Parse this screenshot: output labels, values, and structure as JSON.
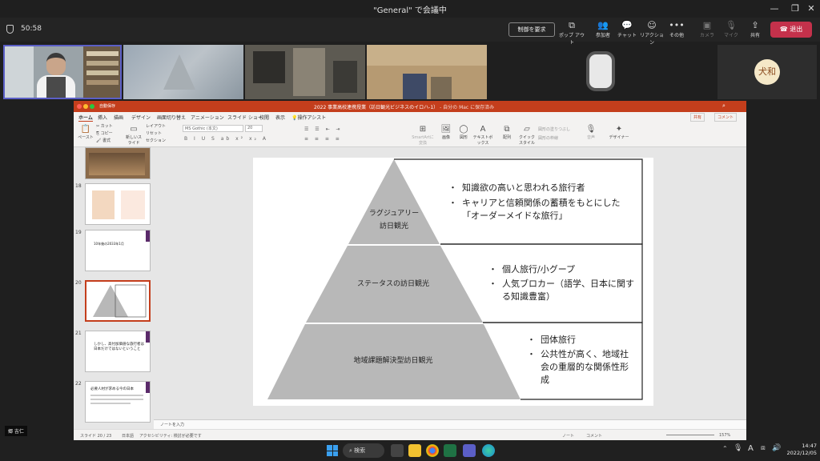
{
  "window": {
    "title": "\"General\" で会議中",
    "controls": {
      "minimize": "—",
      "maximize": "❐",
      "close": "✕"
    }
  },
  "meeting": {
    "timer": "50:58",
    "request_control": "制御を要求",
    "tools": [
      {
        "label": "ポップ アウト",
        "icon": "popout-icon"
      },
      {
        "label": "参加者",
        "icon": "people-icon"
      },
      {
        "label": "チャット",
        "icon": "chat-icon"
      },
      {
        "label": "リアクション",
        "icon": "reaction-icon"
      },
      {
        "label": "その他",
        "icon": "more-icon"
      },
      {
        "label": "カメラ",
        "icon": "camera-off-icon"
      },
      {
        "label": "マイク",
        "icon": "mic-off-icon"
      },
      {
        "label": "共有",
        "icon": "share-icon"
      }
    ],
    "leave": "退出",
    "participant_initials": "犬和",
    "presenter_name": "郷 吉仁"
  },
  "ppt": {
    "title": "2022 事業高校連携授業（訪日観光ビジネスのイロハ-1）",
    "save_state": "- 自分の Mac に保存済み",
    "autosave": "自動保存",
    "tabs": [
      "ホーム",
      "挿入",
      "描画",
      "デザイン",
      "画面切り替え",
      "アニメーション",
      "スライド ショー",
      "校閲",
      "表示",
      "操作アシスト"
    ],
    "share": "共有",
    "comment": "コメント",
    "font_name": "MS Gothic (本文)",
    "font_size": "20",
    "ribbon": {
      "paste": "ペースト",
      "cut": "カット",
      "copy": "コピー",
      "format": "書式",
      "new_slide": "新しいスライド",
      "layout": "レイアウト",
      "reset": "リセット",
      "section": "セクション",
      "smartart": "SmartArtに変換",
      "picture": "画像",
      "shapes": "図形",
      "textbox": "テキストボックス",
      "arrange": "配列",
      "quick_styles": "クイックスタイル",
      "shape_fill": "図形の塗りつぶし",
      "shape_outline": "図形の枠線",
      "dictate": "音声",
      "designer": "デザイナー"
    },
    "thumbnails": [
      {
        "num": "",
        "text": ""
      },
      {
        "num": "18",
        "text": ""
      },
      {
        "num": "19",
        "text": "10年後の2033年1月"
      },
      {
        "num": "20",
        "text": ""
      },
      {
        "num": "21",
        "text": "しかし、高付加価値な旅行者は日本だけではないということ"
      },
      {
        "num": "22",
        "text": "必要人材が求める今の日本"
      }
    ],
    "notes_placeholder": "ノートを入力",
    "status": {
      "slide": "スライド 20 / 23",
      "language": "日本語",
      "accessibility": "アクセシビリティ: 検討が必要です",
      "notes": "ノート",
      "comments": "コメント",
      "zoom": "157%"
    }
  },
  "slide": {
    "tiers": [
      {
        "label_line1": "ラグジュアリー",
        "label_line2": "訪日観光",
        "bullets": [
          "知識欲の高いと思われる旅行者",
          "キャリアと信頼関係の蓄積をもとにした「オーダーメイドな旅行」"
        ]
      },
      {
        "label_line1": "ステータスの訪日観光",
        "label_line2": "",
        "bullets": [
          "個人旅行/小グープ",
          "人気ブロカー（語学、日本に関する知識豊富）"
        ]
      },
      {
        "label_line1": "地域課題解決型訪日観光",
        "label_line2": "",
        "bullets": [
          "団体旅行",
          "公共性が高く、地域社会の重層的な関係性形成"
        ]
      }
    ],
    "pyramid_color": "#b8b8b8"
  },
  "taskbar": {
    "search": "検索",
    "time": "14:47",
    "date": "2022/12/05",
    "ime": "A"
  },
  "colors": {
    "ppt_accent": "#c43e1c",
    "leave_red": "#c4314b",
    "presenter_border": "#5b5fc7"
  }
}
